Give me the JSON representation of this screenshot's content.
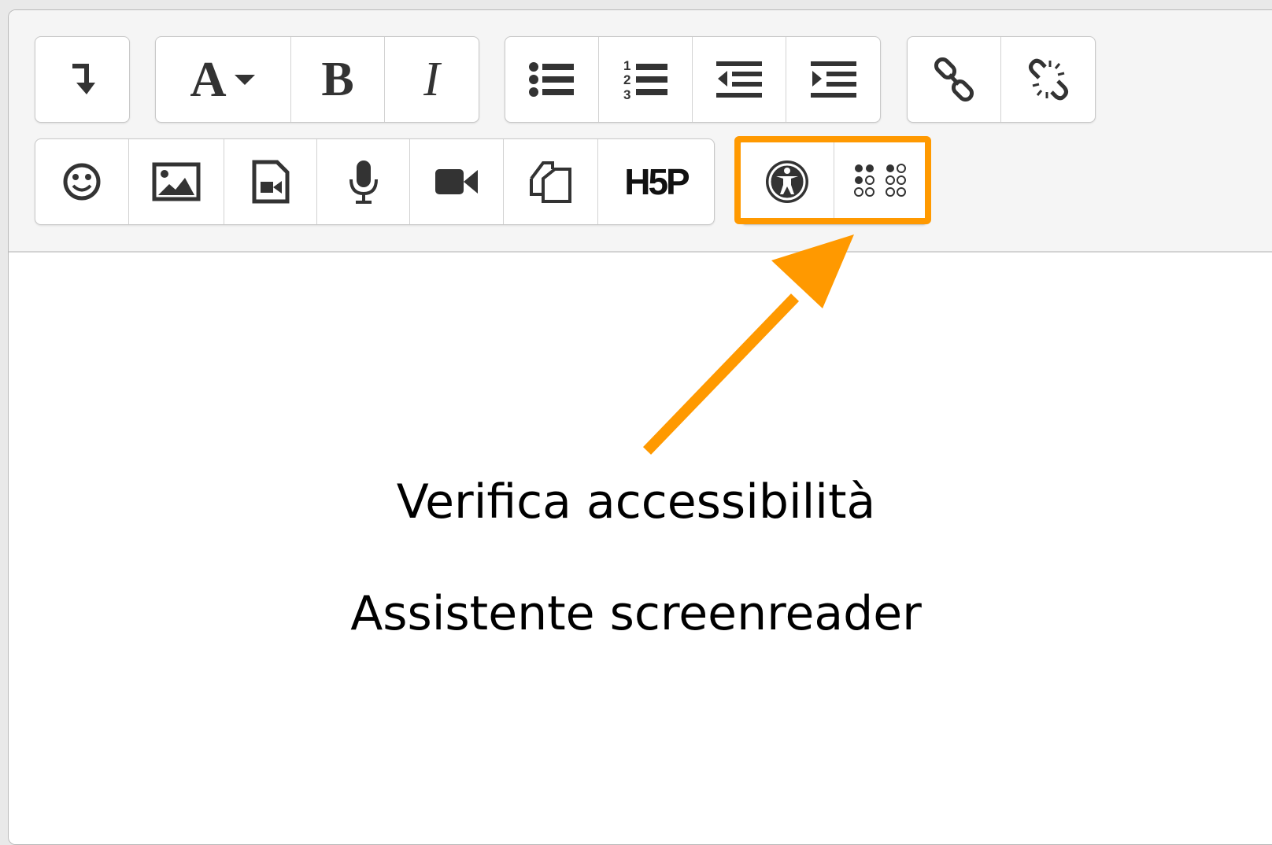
{
  "toolbar": {
    "row1": [
      {
        "group": "expand",
        "buttons": [
          {
            "name": "show-more-buttons-button",
            "icon": "expand-arrow-icon"
          }
        ]
      },
      {
        "group": "style",
        "buttons": [
          {
            "name": "paragraph-styles-button",
            "icon": "font-style-icon",
            "text": "A"
          },
          {
            "name": "bold-button",
            "icon": "bold-icon",
            "text": "B"
          },
          {
            "name": "italic-button",
            "icon": "italic-icon",
            "text": "I"
          }
        ]
      },
      {
        "group": "list",
        "buttons": [
          {
            "name": "unordered-list-button",
            "icon": "bullet-list-icon"
          },
          {
            "name": "ordered-list-button",
            "icon": "numbered-list-icon",
            "text": "123"
          },
          {
            "name": "outdent-button",
            "icon": "outdent-icon"
          },
          {
            "name": "indent-button",
            "icon": "indent-icon"
          }
        ]
      },
      {
        "group": "links",
        "buttons": [
          {
            "name": "link-button",
            "icon": "link-icon"
          },
          {
            "name": "unlink-button",
            "icon": "unlink-icon"
          }
        ]
      }
    ],
    "row2": [
      {
        "group": "media",
        "buttons": [
          {
            "name": "emoji-button",
            "icon": "smiley-icon"
          },
          {
            "name": "image-button",
            "icon": "image-icon"
          },
          {
            "name": "media-button",
            "icon": "media-file-icon"
          },
          {
            "name": "record-audio-button",
            "icon": "microphone-icon"
          },
          {
            "name": "record-video-button",
            "icon": "video-camera-icon"
          },
          {
            "name": "manage-files-button",
            "icon": "copy-files-icon"
          },
          {
            "name": "h5p-button",
            "icon": "h5p-icon",
            "text": "H5P"
          }
        ]
      },
      {
        "group": "accessibility",
        "buttons": [
          {
            "name": "accessibility-checker-button",
            "icon": "accessibility-icon"
          },
          {
            "name": "screenreader-helper-button",
            "icon": "braille-icon"
          }
        ]
      }
    ]
  },
  "annotation": {
    "accent_color": "#ff9900",
    "line1": "Verifica accessibilità",
    "line2": "Assistente screenreader"
  }
}
